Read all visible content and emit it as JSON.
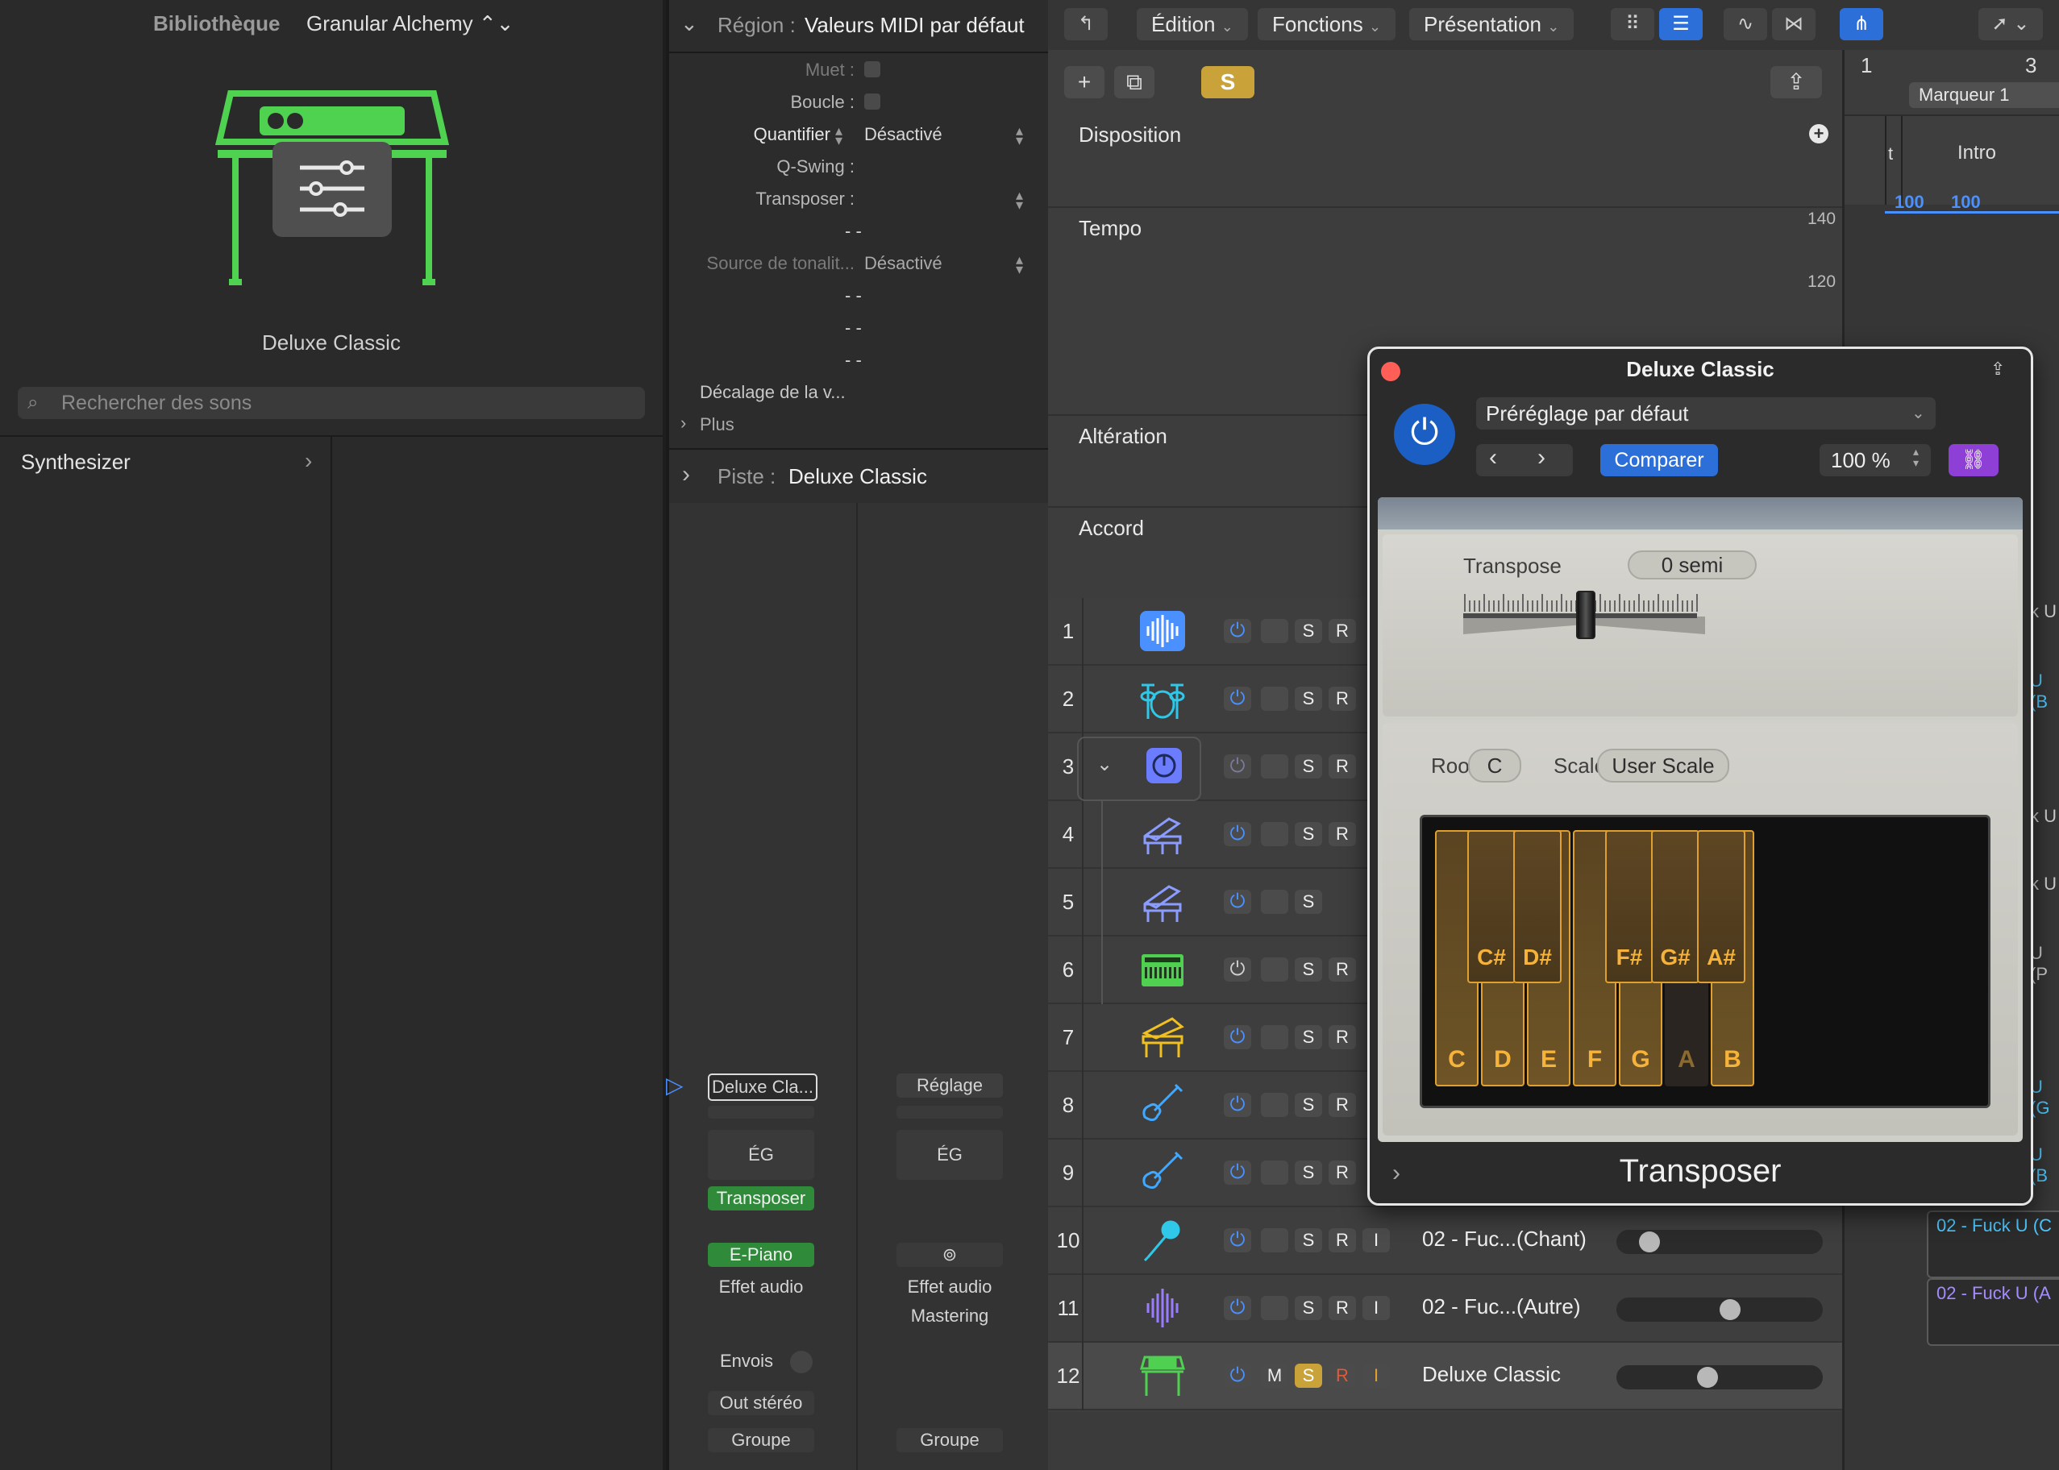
{
  "library": {
    "title": "Bibliothèque",
    "patch": "Granular Alchemy ⌃⌄",
    "patch_name": "Deluxe Classic",
    "search_placeholder": "Rechercher des sons",
    "categories": [
      {
        "label": "Synthesizer"
      }
    ]
  },
  "inspector": {
    "region_label": "Région :",
    "region_value": "Valeurs MIDI par défaut",
    "rows": [
      {
        "label": "Muet :",
        "value": ""
      },
      {
        "label": "Boucle :",
        "value": ""
      },
      {
        "label": "Quantifier",
        "value": "Désactivé"
      },
      {
        "label": "Q-Swing :",
        "value": ""
      },
      {
        "label": "Transposer :",
        "value": ""
      },
      {
        "label": "",
        "value": "- -"
      },
      {
        "label": "Source de tonalit...",
        "value": "Désactivé"
      },
      {
        "label": "",
        "value": "- -"
      },
      {
        "label": "",
        "value": "- -"
      },
      {
        "label": "",
        "value": "- -"
      }
    ],
    "offset_label": "Décalage de la v...",
    "more_label": "Plus",
    "track_label": "Piste :",
    "track_value": "Deluxe Classic",
    "strip_left": {
      "name": "Deluxe Cla...",
      "eq": "ÉG",
      "midi_fx": "Transposer",
      "instrument": "E-Piano",
      "audio_fx": "Effet audio",
      "sends": "Envois",
      "output": "Out stéréo",
      "group": "Groupe"
    },
    "strip_right": {
      "name": "Réglage",
      "eq": "ÉG",
      "audio_fx": "Effet audio",
      "mastering": "Mastering",
      "group": "Groupe"
    }
  },
  "toolbar": {
    "edit": "Édition",
    "functions": "Fonctions",
    "view": "Présentation"
  },
  "lanes": {
    "arrangement": "Disposition",
    "tempo": "Tempo",
    "tempo_max": "140",
    "tempo_min": "120",
    "alteration": "Altération",
    "chord": "Accord"
  },
  "tracks": [
    {
      "num": "1",
      "name": "",
      "icon": "waveform-icon",
      "color": "#4a90ff"
    },
    {
      "num": "2",
      "name": "",
      "icon": "drums-icon",
      "color": "#30c8e8"
    },
    {
      "num": "3",
      "name": "",
      "icon": "stack-icon",
      "color": "#6b7cff"
    },
    {
      "num": "4",
      "name": "",
      "icon": "keyboard-icon",
      "color": "#8a9cff"
    },
    {
      "num": "5",
      "name": "",
      "icon": "keyboard-icon",
      "color": "#8a9cff"
    },
    {
      "num": "6",
      "name": "",
      "icon": "synth-icon",
      "color": "#50d050"
    },
    {
      "num": "7",
      "name": "",
      "icon": "piano-icon",
      "color": "#f0c020"
    },
    {
      "num": "8",
      "name": "",
      "icon": "guitar-icon",
      "color": "#40a8ff"
    },
    {
      "num": "9",
      "name": "",
      "icon": "guitar-icon",
      "color": "#40a8ff"
    },
    {
      "num": "10",
      "name": "02 - Fuc...(Chant)",
      "icon": "microphone-icon",
      "color": "#30c8e8"
    },
    {
      "num": "11",
      "name": "02 - Fuc...(Autre)",
      "icon": "waveform-icon",
      "color": "#9a7cff"
    },
    {
      "num": "12",
      "name": "Deluxe Classic",
      "icon": "electric-piano-icon",
      "color": "#50d050"
    }
  ],
  "track_buttons": {
    "mute": "M",
    "solo": "S",
    "record": "R",
    "input": "I"
  },
  "timeline": {
    "ruler_1": "1",
    "ruler_3": "3",
    "marker": "Marqueur 1",
    "marker_t": "t",
    "intro": "Intro",
    "tempo_a": "100",
    "tempo_b": "100",
    "region_10": "02 - Fuck U (C",
    "region_11": "02 - Fuck U (A",
    "frag_1": "k U",
    "frag_1b": "U (B",
    "frag_4": "k U",
    "frag_5": "k U",
    "frag_6": "U (P",
    "frag_8": "U (G",
    "frag_9": "U (B"
  },
  "plugin": {
    "title": "Deluxe Classic",
    "preset": "Préréglage par défaut",
    "compare": "Comparer",
    "percent": "100 %",
    "transpose_label": "Transpose",
    "transpose_value": "0 semi",
    "transpose_semitones": 0,
    "root_label": "Root",
    "root_value": "C",
    "scale_label": "Scale",
    "scale_value": "User Scale",
    "white_keys": [
      "C",
      "D",
      "E",
      "F",
      "G",
      "A",
      "B"
    ],
    "black_keys": [
      "C#",
      "D#",
      "F#",
      "G#",
      "A#"
    ],
    "disabled_key": "A",
    "footer": "Transposer"
  }
}
